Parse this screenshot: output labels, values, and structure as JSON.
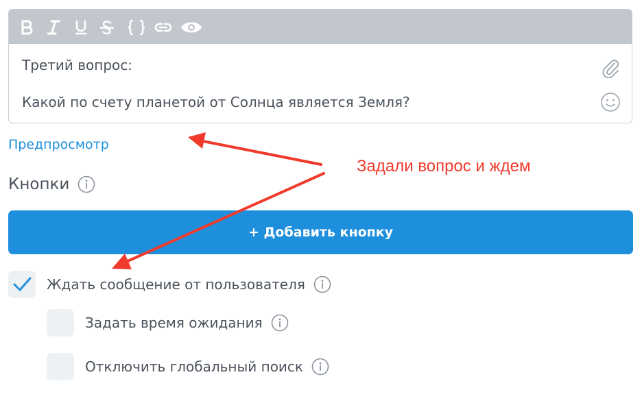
{
  "editor": {
    "toolbar": {
      "bold_icon": "bold-icon",
      "italic_icon": "italic-icon",
      "underline_icon": "underline-icon",
      "strikethrough_icon": "strikethrough-icon",
      "code_icon": "code-braces-icon",
      "link_icon": "link-icon",
      "preview_icon": "eye-icon"
    },
    "lines": [
      "Третий вопрос:",
      "Какой по счету планетой от Солнца является Земля?"
    ],
    "attach_icon": "paperclip-icon",
    "emoji_icon": "smiley-icon"
  },
  "preview_link": "Предпросмотр",
  "buttons_section": {
    "title": "Кнопки",
    "add_button_label": "+ Добавить кнопку"
  },
  "options": [
    {
      "label": "Ждать сообщение от пользователя",
      "checked": true
    },
    {
      "label": "Задать время ожидания",
      "checked": false
    },
    {
      "label": "Отключить глобальный поиск",
      "checked": false
    }
  ],
  "annotation": {
    "text": "Задали вопрос и ждем",
    "color": "#f03a2c"
  },
  "colors": {
    "accent": "#1e8fdc",
    "toolbar_bg": "#c2c7ce",
    "text": "#4a525c",
    "checkbox_bg": "#eef1f4"
  }
}
